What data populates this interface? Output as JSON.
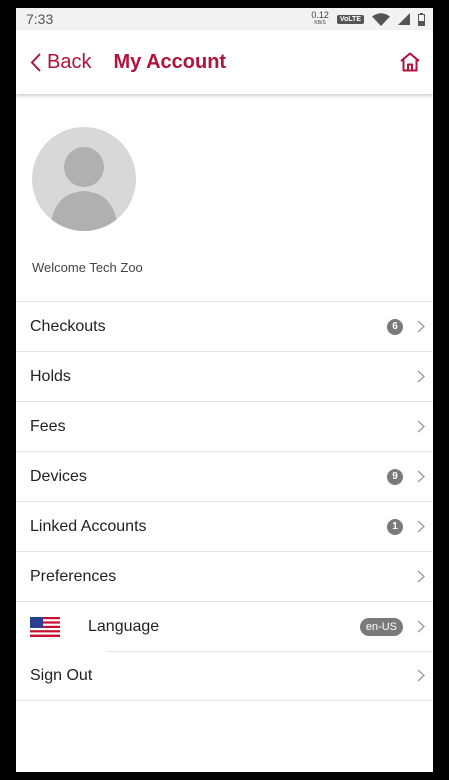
{
  "status_bar": {
    "time": "7:33",
    "speed_value": "0.12",
    "speed_unit": "KB/S",
    "volte": "VoLTE"
  },
  "header": {
    "back_label": "Back",
    "title": "My Account"
  },
  "profile": {
    "welcome": "Welcome Tech Zoo"
  },
  "menu": {
    "items": [
      {
        "label": "Checkouts",
        "badge": "6"
      },
      {
        "label": "Holds"
      },
      {
        "label": "Fees"
      },
      {
        "label": "Devices",
        "badge": "9"
      },
      {
        "label": "Linked Accounts",
        "badge": "1"
      },
      {
        "label": "Preferences"
      },
      {
        "label": "Language",
        "value": "en-US"
      },
      {
        "label": "Sign Out"
      }
    ]
  },
  "colors": {
    "accent": "#b0133c",
    "badge": "#7a7a7a"
  }
}
